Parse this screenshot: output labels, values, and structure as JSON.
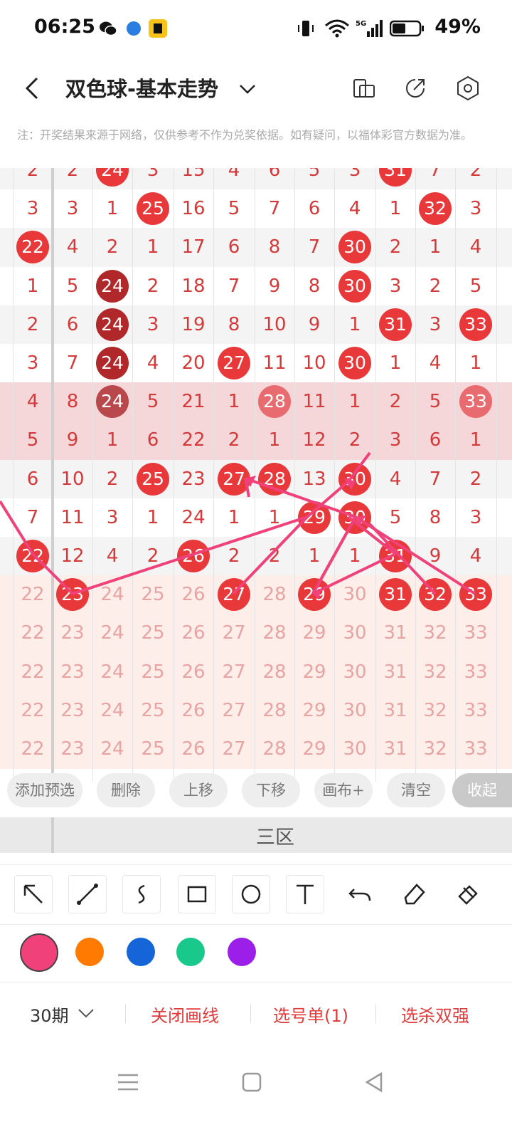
{
  "status_bar": {
    "time": "06:25",
    "battery": "49%"
  },
  "header": {
    "title": "双色球-基本走势"
  },
  "note": "注：开奖结果来源于网络，仅供参考不作为兑奖依据。如有疑问，以福体彩官方数据为准。",
  "chart": {
    "columns_header_values": [
      "22",
      "23",
      "24",
      "25",
      "26",
      "27",
      "28",
      "29",
      "30",
      "31",
      "32",
      "33"
    ],
    "rows": [
      [
        "2",
        "2",
        "24",
        "3",
        "15",
        "4",
        "6",
        "5",
        "3",
        "31",
        "7",
        "2"
      ],
      [
        "3",
        "3",
        "1",
        "25",
        "16",
        "5",
        "7",
        "6",
        "4",
        "1",
        "32",
        "3"
      ],
      [
        "22",
        "4",
        "2",
        "1",
        "17",
        "6",
        "8",
        "7",
        "30",
        "2",
        "1",
        "4"
      ],
      [
        "1",
        "5",
        "24",
        "2",
        "18",
        "7",
        "9",
        "8",
        "30",
        "3",
        "2",
        "5"
      ],
      [
        "2",
        "6",
        "24",
        "3",
        "19",
        "8",
        "10",
        "9",
        "1",
        "31",
        "3",
        "33"
      ],
      [
        "3",
        "7",
        "24",
        "4",
        "20",
        "27",
        "11",
        "10",
        "30",
        "1",
        "4",
        "1"
      ],
      [
        "4",
        "8",
        "24",
        "5",
        "21",
        "1",
        "28",
        "11",
        "1",
        "2",
        "5",
        "33"
      ],
      [
        "5",
        "9",
        "1",
        "6",
        "22",
        "2",
        "1",
        "12",
        "2",
        "3",
        "6",
        "1"
      ],
      [
        "6",
        "10",
        "2",
        "25",
        "23",
        "27",
        "28",
        "13",
        "30",
        "4",
        "7",
        "2"
      ],
      [
        "7",
        "11",
        "3",
        "1",
        "24",
        "1",
        "1",
        "29",
        "30",
        "5",
        "8",
        "3"
      ],
      [
        "22",
        "12",
        "4",
        "2",
        "26",
        "2",
        "2",
        "1",
        "1",
        "31",
        "9",
        "4"
      ],
      [
        "22",
        "23",
        "24",
        "25",
        "26",
        "27",
        "28",
        "29",
        "30",
        "31",
        "32",
        "33"
      ],
      [
        "22",
        "23",
        "24",
        "25",
        "26",
        "27",
        "28",
        "29",
        "30",
        "31",
        "32",
        "33"
      ],
      [
        "22",
        "23",
        "24",
        "25",
        "26",
        "27",
        "28",
        "29",
        "30",
        "31",
        "32",
        "33"
      ],
      [
        "22",
        "23",
        "24",
        "25",
        "26",
        "27",
        "28",
        "29",
        "30",
        "31",
        "32",
        "33"
      ],
      [
        "22",
        "23",
        "24",
        "25",
        "26",
        "27",
        "28",
        "29",
        "30",
        "31",
        "32",
        "33"
      ]
    ]
  },
  "actions": {
    "add_preselect": "添加预选",
    "delete": "删除",
    "move_up": "上移",
    "move_down": "下移",
    "canvas_plus": "画布+",
    "clear": "清空",
    "collapse": "收起"
  },
  "zone_title": "三区",
  "colors": {
    "pink": "#f0417a",
    "orange": "#ff7a00",
    "blue": "#1565d8",
    "green": "#19c98c",
    "purple": "#9b1fe8",
    "ball_red": "#e8383a",
    "ball_dark": "#b0282a"
  },
  "bottom": {
    "period": "30期",
    "close_lines": "关闭画线",
    "pick_list": "选号单(1)",
    "select_kill": "选杀双强"
  }
}
